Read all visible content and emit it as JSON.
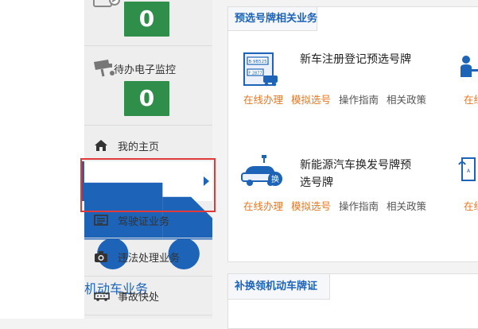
{
  "sidebar": {
    "counter_top": {
      "value": "0"
    },
    "monitor": {
      "label": "待办电子监控",
      "value": "0"
    },
    "nav_items": [
      {
        "label": "我的主页",
        "icon": "home-icon"
      },
      {
        "label": "机动车业务",
        "icon": "truck-icon",
        "active": true
      },
      {
        "label": "驾驶证业务",
        "icon": "id-card-icon"
      },
      {
        "label": "违法处理业务",
        "icon": "camera-icon"
      },
      {
        "label": "事故快处",
        "icon": "accident-icon"
      }
    ]
  },
  "panel1": {
    "title": "预选号牌相关业务",
    "services": [
      {
        "title": "新车注册登记预选号牌",
        "plate_text_1": "B·9B525",
        "plate_text_2": "F·2877",
        "links": [
          "在线办理",
          "模拟选号",
          "操作指南",
          "相关政策"
        ]
      },
      {
        "title": "新能源汽车换发号牌预选号牌",
        "badge": "换",
        "links": [
          "在线办理",
          "模拟选号",
          "操作指南",
          "相关政策"
        ]
      }
    ],
    "partial_link_1": "在线",
    "partial_link_2": "在线"
  },
  "panel2": {
    "title": "补换领机动车牌证"
  },
  "colors": {
    "accent": "#1d63b8",
    "counter_green": "#2f8f4a",
    "link_orange": "#e87722",
    "highlight_red": "#e03a3a"
  }
}
